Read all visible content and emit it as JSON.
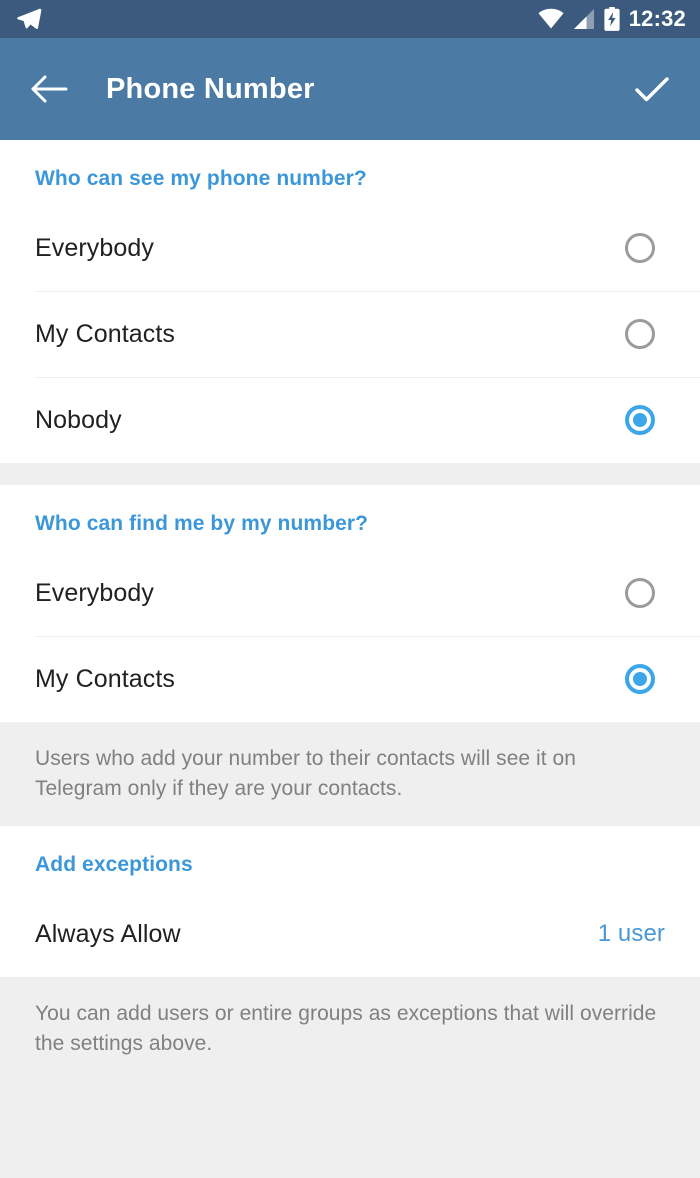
{
  "status_bar": {
    "app_icon": "telegram-paper-plane-icon",
    "wifi_icon": "wifi-icon",
    "signal_icon": "cellular-signal-icon",
    "battery_icon": "battery-charging-icon",
    "clock": "12:32"
  },
  "toolbar": {
    "back_icon": "back-arrow-icon",
    "title": "Phone Number",
    "done_icon": "check-icon",
    "background_color": "#4b7ba4"
  },
  "colors": {
    "accent_blue": "#3ba7e8",
    "header_blue": "#3c97da",
    "value_blue": "#4a97d6",
    "status_bar": "#3b5a7d",
    "toolbar": "#4b7ba4",
    "page_background": "#efefef",
    "card_background": "#ffffff",
    "primary_text": "#212121",
    "secondary_text": "#808080",
    "divider": "#ededed",
    "radio_unchecked": "#9b9b9b"
  },
  "sections": [
    {
      "header": "Who can see my phone number?",
      "options": [
        {
          "label": "Everybody",
          "selected": false
        },
        {
          "label": "My Contacts",
          "selected": false
        },
        {
          "label": "Nobody",
          "selected": true
        }
      ]
    },
    {
      "header": "Who can find me by my number?",
      "options": [
        {
          "label": "Everybody",
          "selected": false
        },
        {
          "label": "My Contacts",
          "selected": true
        }
      ],
      "footer": "Users who add your number to their contacts will see it on Telegram only if they are your contacts."
    },
    {
      "header": "Add exceptions",
      "rows": [
        {
          "label": "Always Allow",
          "value": "1 user"
        }
      ],
      "footer": "You can add users or entire groups as exceptions that will override the settings above."
    }
  ]
}
